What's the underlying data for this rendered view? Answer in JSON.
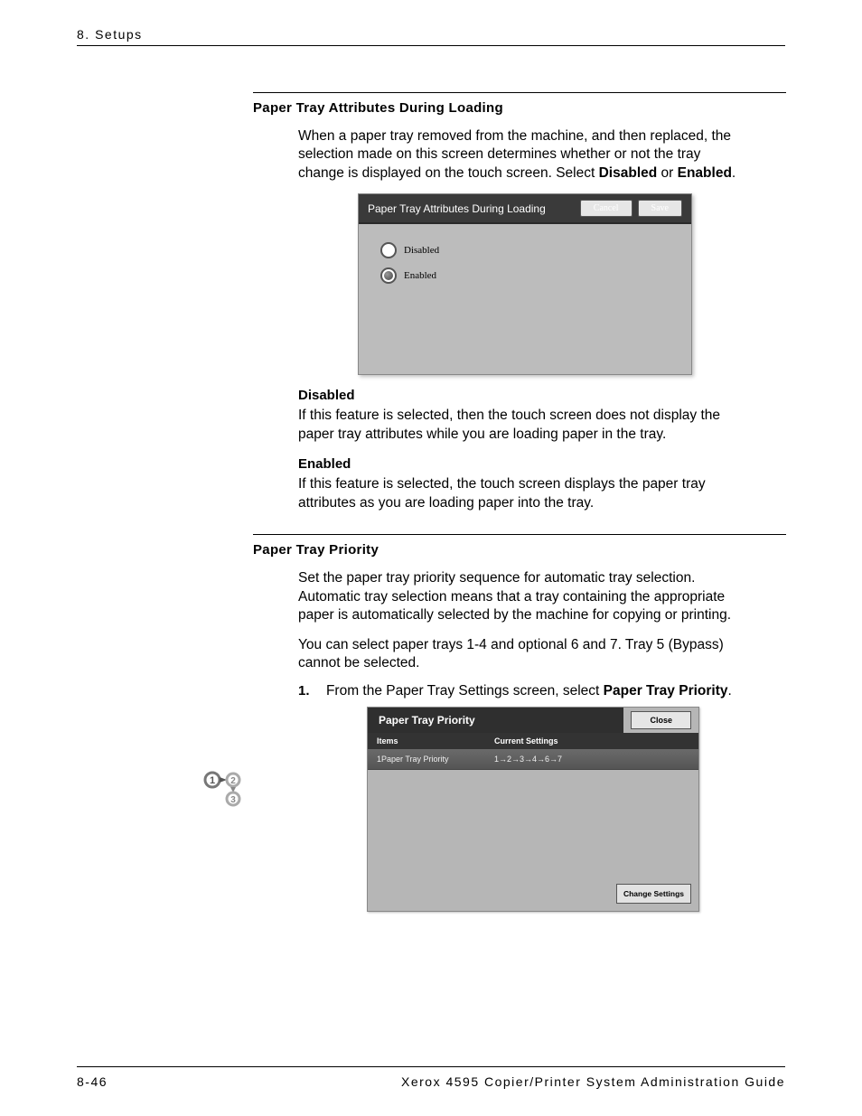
{
  "header": {
    "chapter": "8. Setups"
  },
  "section1": {
    "heading": "Paper Tray Attributes During Loading",
    "para": "When a paper tray removed from the machine, and then replaced, the selection made on this screen determines whether or not the tray change is displayed on the touch screen.  Select ",
    "bold1": "Disabled",
    "mid": " or ",
    "bold2": "Enabled",
    "end": ".",
    "panel": {
      "title": "Paper Tray Attributes During Loading",
      "cancel": "Cancel",
      "save": "Save",
      "opt1": "Disabled",
      "opt2": "Enabled"
    },
    "subA": {
      "h": "Disabled",
      "p": "If this feature is selected, then the touch screen does not display the paper tray attributes while you are loading paper in the tray."
    },
    "subB": {
      "h": "Enabled",
      "p": "If this feature is selected, the touch screen displays the paper tray attributes as you are loading paper into the tray."
    }
  },
  "section2": {
    "heading": "Paper Tray Priority",
    "para1": "Set the paper tray priority sequence for automatic tray selection.  Automatic tray selection means that a tray containing the appropriate paper is automatically selected by the machine for copying or printing.",
    "para2": "You can select paper trays 1-4 and optional 6 and 7. Tray 5 (Bypass) cannot be selected.",
    "step_no": "1.",
    "step_a": "From the Paper Tray Settings screen, select ",
    "step_bold": "Paper Tray Priority",
    "step_end": ".",
    "panel": {
      "title": "Paper Tray Priority",
      "close": "Close",
      "col1": "Items",
      "col2": "Current Settings",
      "row1a": "1Paper Tray Priority",
      "row1b": "1→2→3→4→6→7",
      "change": "Change Settings"
    }
  },
  "footer": {
    "left": "8-46",
    "right": "Xerox 4595 Copier/Printer System Administration Guide"
  }
}
